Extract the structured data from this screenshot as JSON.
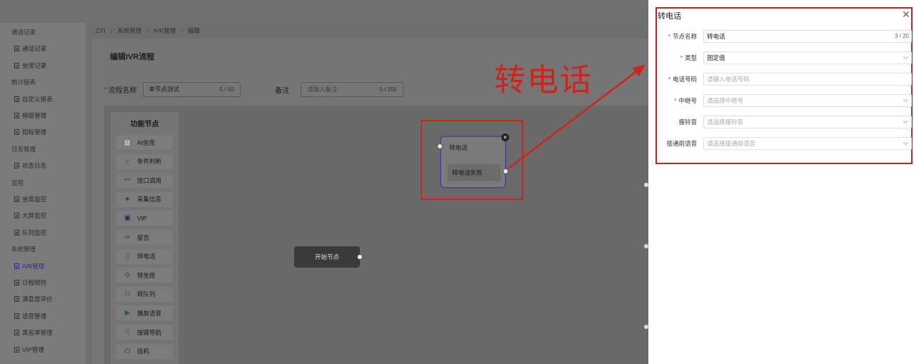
{
  "sidebar": {
    "rows": [
      {
        "kind": "group",
        "label": "通话记录",
        "active": false
      },
      {
        "kind": "item",
        "label": "通话记录",
        "active": false
      },
      {
        "kind": "item",
        "label": "坐席记录",
        "active": false
      },
      {
        "kind": "group",
        "label": "统计报表",
        "active": false
      },
      {
        "kind": "item",
        "label": "自定义报表",
        "active": false
      },
      {
        "kind": "item",
        "label": "模版管理",
        "active": false
      },
      {
        "kind": "item",
        "label": "指标管理",
        "active": false
      },
      {
        "kind": "group",
        "label": "日志管理",
        "active": false
      },
      {
        "kind": "item",
        "label": "状态日志",
        "active": false
      },
      {
        "kind": "group",
        "label": "监控",
        "active": false
      },
      {
        "kind": "item",
        "label": "坐席监控",
        "active": false
      },
      {
        "kind": "item",
        "label": "大屏监控",
        "active": false
      },
      {
        "kind": "item",
        "label": "队列监控",
        "active": false
      },
      {
        "kind": "group",
        "label": "系统管理",
        "active": false
      },
      {
        "kind": "item",
        "label": "IVR管理",
        "active": true
      },
      {
        "kind": "item",
        "label": "日程规则",
        "active": false
      },
      {
        "kind": "item",
        "label": "满意度评价",
        "active": false
      },
      {
        "kind": "item",
        "label": "语音管理",
        "active": false
      },
      {
        "kind": "item",
        "label": "黑名单管理",
        "active": false
      },
      {
        "kind": "item",
        "label": "VIP管理",
        "active": false
      }
    ]
  },
  "breadcrumb": {
    "items": [
      "CTI",
      "系统管理",
      "IVR管理",
      "编辑"
    ],
    "separator": ">"
  },
  "page": {
    "title": "编辑IVR流程",
    "flow_name_label": "流程名称",
    "flow_name_value": "单节点测试",
    "flow_name_count": "5 / 50",
    "remark_label": "备注",
    "remark_placeholder": "请输入备注",
    "remark_count": "0 / 255"
  },
  "palette": {
    "title": "功能节点",
    "items": [
      {
        "label": "AI坐席",
        "icon": "robot-icon",
        "glyph": "🤖",
        "color": "#7a4b1a"
      },
      {
        "label": "条件判断",
        "icon": "branch-icon",
        "glyph": "⑂",
        "color": "#7a2a1a"
      },
      {
        "label": "接口调用",
        "icon": "plug-icon",
        "glyph": "⚯",
        "color": "#6a2a6a"
      },
      {
        "label": "采集信息",
        "icon": "collect-icon",
        "glyph": "✦",
        "color": "#3a2a7a"
      },
      {
        "label": "VIP",
        "icon": "vip-icon",
        "glyph": "▣",
        "color": "#2a2a6a"
      },
      {
        "label": "留言",
        "icon": "voicemail-icon",
        "glyph": "∞",
        "color": "#1a3a7a"
      },
      {
        "label": "转电话",
        "icon": "phone-icon",
        "glyph": "▯",
        "color": "#2a5a3a"
      },
      {
        "label": "转坐席",
        "icon": "agent-icon",
        "glyph": "☺",
        "color": "#222222"
      },
      {
        "label": "转队列",
        "icon": "queue-icon",
        "glyph": "⚇",
        "color": "#1a5a4a"
      },
      {
        "label": "播放语音",
        "icon": "play-icon",
        "glyph": "▶",
        "color": "#1a6a2a"
      },
      {
        "label": "按键导航",
        "icon": "keypad-icon",
        "glyph": "⠿",
        "color": "#6a5a1a"
      },
      {
        "label": "挂机",
        "icon": "power-icon",
        "glyph": "⏻",
        "color": "#3a2a7a"
      }
    ]
  },
  "canvas": {
    "start_node_label": "开始节点",
    "transfer_node_title": "转电话",
    "transfer_node_fail": "转电话失败",
    "close_glyph": "×"
  },
  "annotation": {
    "caption": "转电话",
    "color": "#d2231b"
  },
  "drawer": {
    "title": "转电话",
    "close_glyph": "✕",
    "fields": [
      {
        "label": "节点名称",
        "required": true,
        "value": "转电话",
        "placeholder": "",
        "count": "3 / 20",
        "kind": "text"
      },
      {
        "label": "类型",
        "required": true,
        "value": "固定值",
        "placeholder": "",
        "count": "",
        "kind": "select"
      },
      {
        "label": "电话号码",
        "required": true,
        "value": "",
        "placeholder": "请输入电话号码",
        "count": "",
        "kind": "text"
      },
      {
        "label": "中继号",
        "required": true,
        "value": "",
        "placeholder": "请选择中继号",
        "count": "",
        "kind": "select"
      },
      {
        "label": "振铃音",
        "required": false,
        "value": "",
        "placeholder": "请选择振铃音",
        "count": "",
        "kind": "select"
      },
      {
        "label": "接通前语音",
        "required": false,
        "value": "",
        "placeholder": "请选择接通前语音",
        "count": "",
        "kind": "select"
      }
    ]
  },
  "colors": {
    "accent_purple": "#55489a",
    "highlight_red": "#d2231b",
    "required_star": "#e13c3c"
  }
}
